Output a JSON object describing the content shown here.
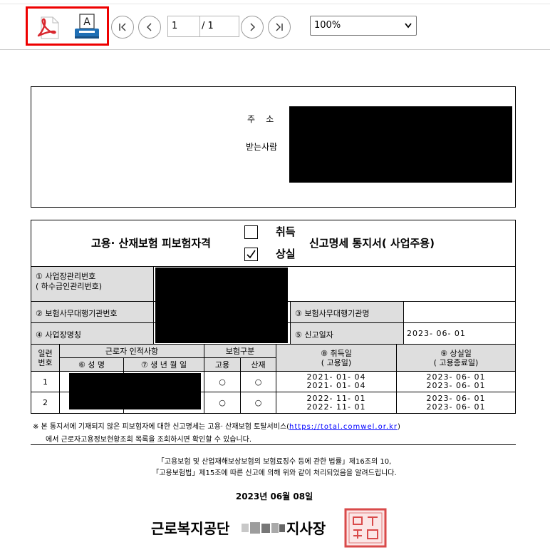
{
  "toolbar": {
    "page_current": "1",
    "page_total": "/ 1",
    "zoom": "100%"
  },
  "address": {
    "addr_label": "주    소",
    "recipient_label": "받는사람"
  },
  "form": {
    "title_left": "고용· 산재보험 피보험자격",
    "opt_acquire": "취득",
    "opt_loss": "상실",
    "title_right": "신고명세 통지서( 사업주용)",
    "f1_line1": "① 사업장관리번호",
    "f1_line2": "( 하수급인관리번호)",
    "f2": "② 보험사무대행기관번호",
    "f3": "③ 보험사무대행기관명",
    "f4": "④ 사업장명칭",
    "f5": "⑤ 신고일자",
    "report_date": "2023- 06- 01",
    "hdr_serial_1": "일련",
    "hdr_serial_2": "번호",
    "hdr_worker": "근로자 인적사항",
    "hdr_insurance": "보험구분",
    "hdr_acq_1": "⑧ 취득일",
    "hdr_acq_2": "( 고용일)",
    "hdr_loss_1": "⑨ 상실일",
    "hdr_loss_2": "( 고용종료일)",
    "hdr_name": "⑥ 성  명",
    "hdr_birth": "⑦ 생  년  월  일",
    "hdr_emp": "고용",
    "hdr_ind": "산재",
    "rows": [
      {
        "no": "1",
        "emp": "○",
        "ind": "○",
        "acq1": "2021- 01- 04",
        "acq2": "2021- 01- 04",
        "loss1": "2023- 06- 01",
        "loss2": "2023- 06- 01"
      },
      {
        "no": "2",
        "emp": "○",
        "ind": "○",
        "acq1": "2022- 11- 01",
        "acq2": "2022- 11- 01",
        "loss1": "2023- 06- 01",
        "loss2": "2023- 06- 01"
      }
    ]
  },
  "notice": {
    "line1_pre": "※  본 통지서에 기재되지 않은 피보험자에 대한 신고명세는 고용· 산재보험 토탈서비스(",
    "link": "https://total.comwel.or.kr",
    "line1_post": ")",
    "line2": "에서 근로자고용정보현황조회 목록을 조회하시면 확인할 수 있습니다."
  },
  "law": {
    "line1": "「고용보험 및 산업재해보상보험의 보험료징수 등에 관한 법률」제16조의 10,",
    "line2": "「고용보험법」제15조에 따른 신고에 의해 위와 같이 처리되었음을 알려드립니다."
  },
  "date": "2023년 06월 08일",
  "signature": {
    "org": "근로복지공단",
    "title": "지사장"
  },
  "colors": {
    "highlight_box": "#e00000",
    "pdf_icon": "#d9282f",
    "printer_icon": "#1f6fb5",
    "header_gray": "#dedede"
  }
}
